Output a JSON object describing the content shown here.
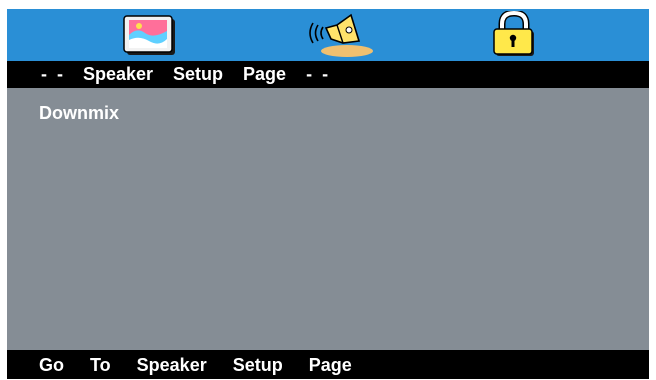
{
  "icon_bar": {
    "icons": [
      "picture-setup-icon",
      "speaker-setup-icon",
      "password-lock-icon"
    ],
    "background": "#2a8fd6",
    "selected": "speaker-setup-icon"
  },
  "page_title": "- -  Speaker  Setup  Page  - -",
  "menu": {
    "items": [
      {
        "label": "Downmix"
      }
    ]
  },
  "status_bar": {
    "text": "Go  To  Speaker  Setup  Page"
  },
  "colors": {
    "content_background": "#858d95",
    "bars": "#000000",
    "text": "#ffffff"
  }
}
